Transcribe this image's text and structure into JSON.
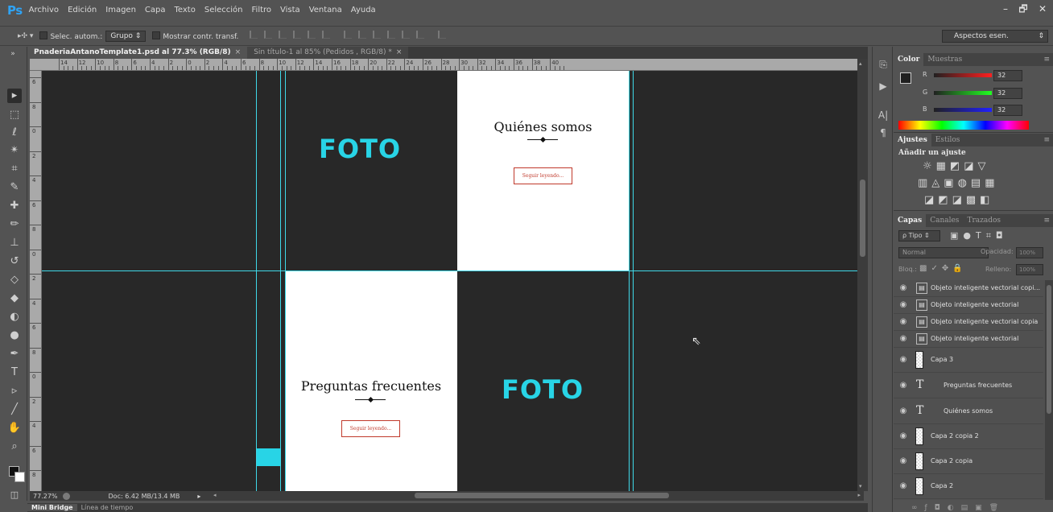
{
  "app": {
    "logo": "Ps",
    "menu": [
      "Archivo",
      "Edición",
      "Imagen",
      "Capa",
      "Texto",
      "Selección",
      "Filtro",
      "Vista",
      "Ventana",
      "Ayuda"
    ],
    "window_controls": {
      "minimize": "–",
      "maximize": "🗗",
      "close": "✕"
    }
  },
  "options": {
    "auto_select_label": "Selec. autom.:",
    "auto_select_value": "Grupo",
    "show_transform_label": "Mostrar contr. transf.",
    "workspace": "Aspectos esen."
  },
  "tabs": [
    {
      "label": "PnaderiaAntanoTemplate1.psd al 77.3% (RGB/8)",
      "close": "×"
    },
    {
      "label": "Sin título-1 al 85% (Pedidos , RGB/8) *",
      "close": "×"
    }
  ],
  "ruler": {
    "top_labels": [
      "14",
      "12",
      "10",
      "8",
      "6",
      "4",
      "2",
      "0",
      "2",
      "4",
      "6",
      "8",
      "10",
      "12",
      "14",
      "16",
      "18",
      "20",
      "22",
      "24",
      "26",
      "28",
      "30",
      "32",
      "34",
      "36",
      "38",
      "40"
    ],
    "left_labels": [
      "6",
      "8",
      "0",
      "2",
      "4",
      "6",
      "8",
      "0",
      "2",
      "4",
      "6",
      "8",
      "0",
      "2",
      "4",
      "6",
      "8"
    ]
  },
  "canvas": {
    "foto_1": "FOTO",
    "foto_2": "FOTO",
    "quienes_title": "Quiénes somos",
    "quienes_button": "Seguir leyendo...",
    "preguntas_title": "Preguntas frecuentes",
    "preguntas_button": "Seguir leyendo...",
    "accent_color": "#28d4e6",
    "guide_color": "#3fd8e8"
  },
  "status": {
    "zoom": "77.27%",
    "doc": "Doc: 6.42 MB/13.4 MB"
  },
  "bottom_tabs": [
    "Mini Bridge",
    "Línea de tiempo"
  ],
  "color_panel": {
    "tabs": [
      "Color",
      "Muestras"
    ],
    "channels": [
      {
        "label": "R",
        "value": "32"
      },
      {
        "label": "G",
        "value": "32"
      },
      {
        "label": "B",
        "value": "32"
      }
    ]
  },
  "adjust_panel": {
    "tabs": [
      "Ajustes",
      "Estilos"
    ],
    "title": "Añadir un ajuste"
  },
  "layers_panel": {
    "tabs": [
      "Capas",
      "Canales",
      "Trazados"
    ],
    "filter": "ρ Tipo",
    "blend_mode": "Normal",
    "opacity_label": "Opacidad:",
    "opacity_value": "100%",
    "lock_label": "Bloq.:",
    "fill_label": "Relleno:",
    "fill_value": "100%",
    "layers": [
      {
        "name": "Objeto inteligente vectorial copi...",
        "kind": "smart"
      },
      {
        "name": "Objeto inteligente vectorial",
        "kind": "smart"
      },
      {
        "name": "Objeto inteligente vectorial copia",
        "kind": "smart"
      },
      {
        "name": "Objeto inteligente vectorial",
        "kind": "smart"
      },
      {
        "name": "Capa 3",
        "kind": "pixel"
      },
      {
        "name": "Preguntas frecuentes",
        "kind": "text",
        "glyph": "T"
      },
      {
        "name": "Quiénes somos",
        "kind": "text",
        "glyph": "T"
      },
      {
        "name": "Capa 2 copia 2",
        "kind": "pixel"
      },
      {
        "name": "Capa 2 copia",
        "kind": "pixel"
      },
      {
        "name": "Capa 2",
        "kind": "pixel"
      }
    ]
  }
}
